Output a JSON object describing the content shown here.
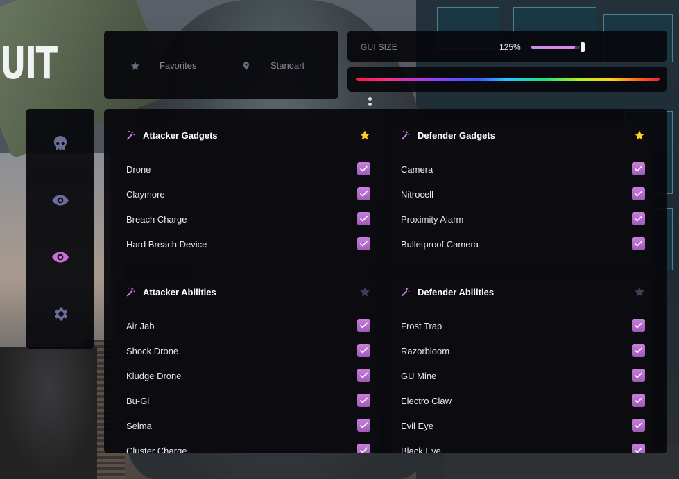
{
  "brand": {
    "logo_text": "UIT"
  },
  "nav": {
    "favorites_label": "Favorites",
    "favorites_icon": "star-icon",
    "standart_label": "Standart",
    "standart_icon": "map-pin-icon"
  },
  "gui_size": {
    "label": "GUI SIZE",
    "value_text": "125%",
    "slider_fraction": 0.9
  },
  "sidebar": {
    "icons": [
      "skull-icon",
      "eye-icon",
      "eye-icon-active",
      "gear-icon"
    ],
    "active_index": 2
  },
  "colors": {
    "accent": "#d48ae8",
    "checkbox": "#b06ecb",
    "star_active": "#ffd21a",
    "star_inactive": "#3c3f55"
  },
  "cards": [
    {
      "title": "Attacker Gadgets",
      "favorited": true,
      "items": [
        {
          "label": "Drone",
          "checked": true
        },
        {
          "label": "Claymore",
          "checked": true
        },
        {
          "label": "Breach Charge",
          "checked": true
        },
        {
          "label": "Hard Breach Device",
          "checked": true
        }
      ]
    },
    {
      "title": "Defender Gadgets",
      "favorited": true,
      "items": [
        {
          "label": "Camera",
          "checked": true
        },
        {
          "label": "Nitrocell",
          "checked": true
        },
        {
          "label": "Proximity Alarm",
          "checked": true
        },
        {
          "label": "Bulletproof Camera",
          "checked": true
        }
      ]
    },
    {
      "title": "Attacker Abilities",
      "favorited": false,
      "items": [
        {
          "label": "Air Jab",
          "checked": true
        },
        {
          "label": "Shock Drone",
          "checked": true
        },
        {
          "label": "Kludge Drone",
          "checked": true
        },
        {
          "label": "Bu-Gi",
          "checked": true
        },
        {
          "label": "Selma",
          "checked": true
        },
        {
          "label": "Cluster Charge",
          "checked": true
        }
      ]
    },
    {
      "title": "Defender Abilities",
      "favorited": false,
      "items": [
        {
          "label": "Frost Trap",
          "checked": true
        },
        {
          "label": "Razorbloom",
          "checked": true
        },
        {
          "label": "GU Mine",
          "checked": true
        },
        {
          "label": "Electro Claw",
          "checked": true
        },
        {
          "label": "Evil Eye",
          "checked": true
        },
        {
          "label": "Black Eye",
          "checked": true
        }
      ]
    }
  ]
}
